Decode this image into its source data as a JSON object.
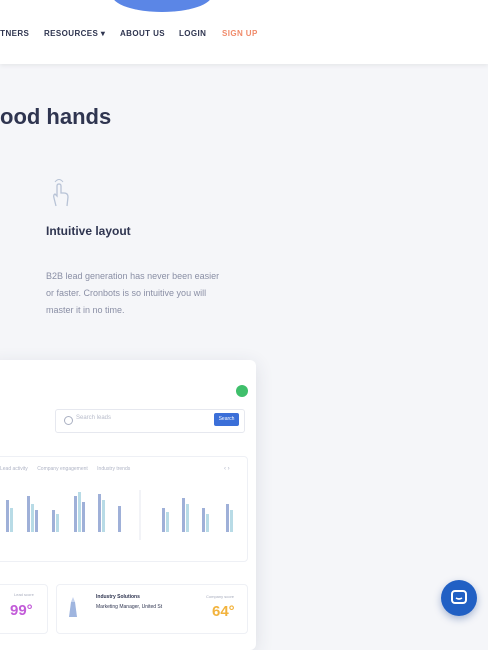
{
  "nav": {
    "items": [
      "RTNERS",
      "RESOURCES ▾",
      "ABOUT US",
      "LOGIN",
      "SIGN UP"
    ]
  },
  "hero": {
    "headline": "ood hands"
  },
  "feature": {
    "icon": "hand-tap-icon",
    "title": "Intuitive layout",
    "description": "B2B lead generation has never been easier or faster. Cronbots is so intuitive you will master it in no time."
  },
  "dashboard": {
    "search_placeholder": "Search leads",
    "search_button": "Search",
    "chart_tabs": [
      "Lead activity",
      "Company engagement",
      "Industry trends"
    ],
    "left_card": {
      "label": "Lead score",
      "score": "99°"
    },
    "company_card": {
      "name": "Industry Solutions",
      "meta": "Marketing Manager, United St",
      "score_label": "Company score",
      "score": "64°"
    }
  },
  "colors": {
    "accent_blue": "#3b6fd8",
    "signup": "#f08a6a",
    "status_green": "#3fbf6b",
    "score_purple": "#c25bd8",
    "score_amber": "#f2b33d",
    "chat": "#2160c4"
  },
  "chat": {
    "icon": "chat-bubble-icon"
  }
}
